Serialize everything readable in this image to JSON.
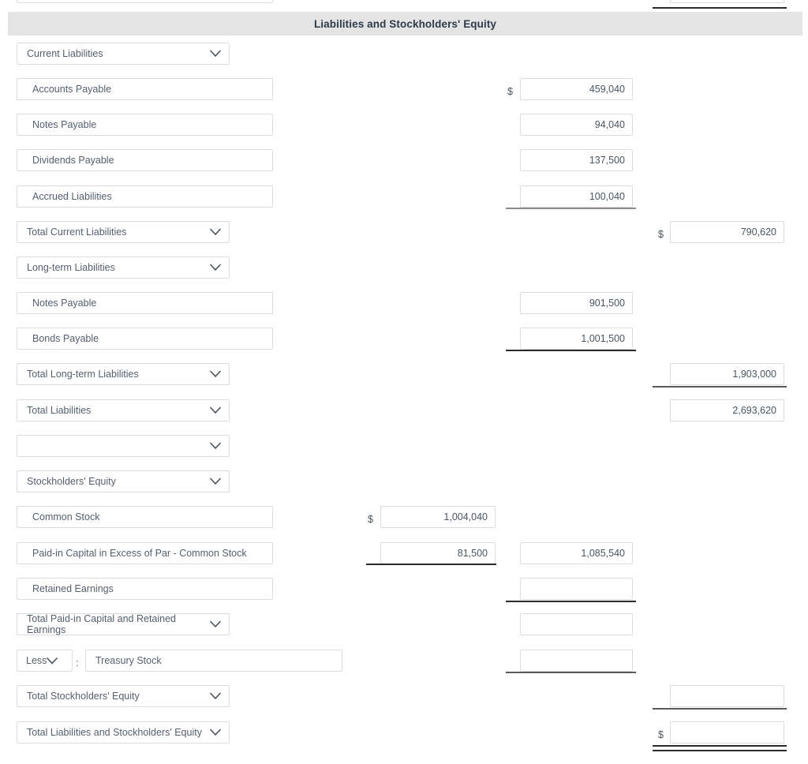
{
  "section": {
    "title": "Liabilities and Stockholders' Equity"
  },
  "symbols": {
    "dollar": "$",
    "colon": ":"
  },
  "rows": [
    {
      "key": "partial_top",
      "label": "",
      "type": "input",
      "col_c": ""
    },
    {
      "key": "current_liabilities",
      "label": "Current Liabilities",
      "type": "select",
      "col_b": ""
    },
    {
      "key": "accounts_payable",
      "label": "Accounts Payable",
      "type": "input",
      "col_b": "459,040"
    },
    {
      "key": "notes_payable_current",
      "label": "Notes Payable",
      "type": "input",
      "col_b": "94,040"
    },
    {
      "key": "dividends_payable",
      "label": "Dividends Payable",
      "type": "input",
      "col_b": "137,500"
    },
    {
      "key": "accrued_liabilities",
      "label": "Accrued Liabilities",
      "type": "input",
      "col_b": "100,040"
    },
    {
      "key": "total_current_liabilities",
      "label": "Total Current Liabilities",
      "type": "select",
      "col_c": "790,620"
    },
    {
      "key": "long_term_liabilities",
      "label": "Long-term Liabilities",
      "type": "select"
    },
    {
      "key": "notes_payable_lt",
      "label": "Notes Payable",
      "type": "input",
      "col_b": "901,500"
    },
    {
      "key": "bonds_payable",
      "label": "Bonds Payable",
      "type": "input",
      "col_b": "1,001,500"
    },
    {
      "key": "total_long_term_liabilities",
      "label": "Total Long-term Liabilities",
      "type": "select",
      "col_c": "1,903,000"
    },
    {
      "key": "total_liabilities",
      "label": "Total Liabilities",
      "type": "select",
      "col_c": "2,693,620"
    },
    {
      "key": "blank_select",
      "label": "",
      "type": "select"
    },
    {
      "key": "stockholders_equity",
      "label": "Stockholders' Equity",
      "type": "select"
    },
    {
      "key": "common_stock",
      "label": "Common Stock",
      "type": "input",
      "col_a": "1,004,040"
    },
    {
      "key": "paid_in_capital_excess_par",
      "label": "Paid-in Capital in Excess of Par - Common Stock",
      "type": "input",
      "col_a": "81,500",
      "col_b": "1,085,540"
    },
    {
      "key": "retained_earnings",
      "label": "Retained Earnings",
      "type": "input",
      "col_b": ""
    },
    {
      "key": "total_paid_in_capital_and_retained_earnings",
      "label": "Total Paid-in Capital and Retained Earnings",
      "type": "select",
      "col_b": ""
    },
    {
      "key": "treasury_stock",
      "label": "Treasury Stock",
      "type": "less",
      "less_label": "Less",
      "col_b": ""
    },
    {
      "key": "total_stockholders_equity",
      "label": "Total Stockholders' Equity",
      "type": "select",
      "col_c": ""
    },
    {
      "key": "total_liabilities_and_stockholders_equity",
      "label": "Total Liabilities and Stockholders' Equity",
      "type": "select",
      "col_c": ""
    }
  ]
}
